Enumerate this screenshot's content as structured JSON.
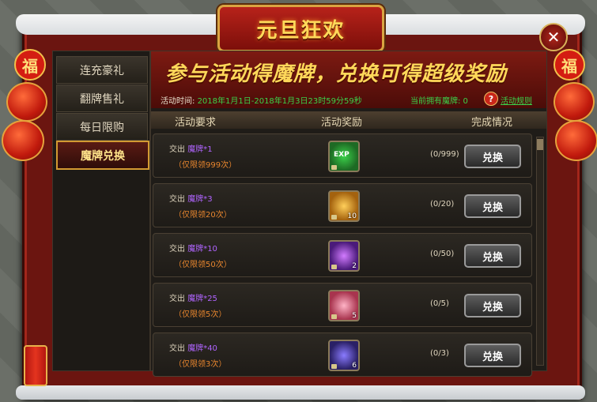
{
  "title": "元旦狂欢",
  "sidebar": {
    "tabs": [
      {
        "label": "连充豪礼",
        "active": false
      },
      {
        "label": "翻牌售礼",
        "active": false
      },
      {
        "label": "每日限购",
        "active": false
      },
      {
        "label": "魔牌兑换",
        "active": true
      }
    ]
  },
  "banner": {
    "headline": "参与活动得魔牌，兑换可得超级奖励",
    "time_label": "活动时间:",
    "time_value": "2018年1月1日-2018年1月3日23时59分59秒",
    "owned_label": "当前拥有魔牌: 0",
    "rules_link": "活动规则"
  },
  "columns": {
    "requirement": "活动要求",
    "reward": "活动奖励",
    "status": "完成情况"
  },
  "rows": [
    {
      "req_prefix": "交出 ",
      "req_item": "魔牌",
      "req_count": "*1",
      "limit": "（仅限领999次）",
      "reward_qty": "",
      "reward_icon": "exp-orb-icon",
      "progress": "(0/999)",
      "button": "兑换"
    },
    {
      "req_prefix": "交出 ",
      "req_item": "魔牌",
      "req_count": "*3",
      "limit": "（仅限领20次）",
      "reward_qty": "10",
      "reward_icon": "feather-icon",
      "progress": "(0/20)",
      "button": "兑换"
    },
    {
      "req_prefix": "交出 ",
      "req_item": "魔牌",
      "req_count": "*10",
      "limit": "（仅限领50次）",
      "reward_qty": "2",
      "reward_icon": "purple-orb-icon",
      "progress": "(0/50)",
      "button": "兑换"
    },
    {
      "req_prefix": "交出 ",
      "req_item": "魔牌",
      "req_count": "*25",
      "limit": "（仅限领5次）",
      "reward_qty": "5",
      "reward_icon": "lotus-icon",
      "progress": "(0/5)",
      "button": "兑换"
    },
    {
      "req_prefix": "交出 ",
      "req_item": "魔牌",
      "req_count": "*40",
      "limit": "（仅限领3次）",
      "reward_qty": "6",
      "reward_icon": "star-gem-icon",
      "progress": "(0/3)",
      "button": "兑换"
    }
  ],
  "colors": {
    "accent_gold": "#ffd85a",
    "frame_red": "#6b1510",
    "green_text": "#3bd24a",
    "purple_item": "#b064ff",
    "orange_limit": "#e8862e"
  }
}
